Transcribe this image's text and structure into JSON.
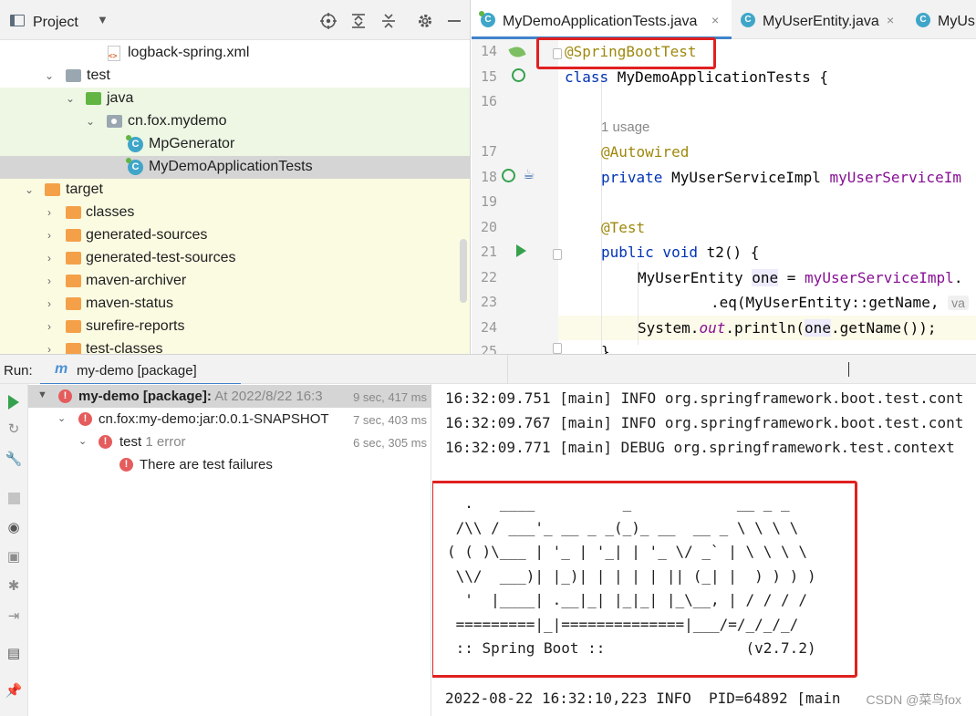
{
  "project": {
    "title": "Project",
    "tree": [
      {
        "label": "logback-spring.xml"
      },
      {
        "label": "test"
      },
      {
        "label": "java"
      },
      {
        "label": "cn.fox.mydemo"
      },
      {
        "label": "MpGenerator"
      },
      {
        "label": "MyDemoApplicationTests"
      },
      {
        "label": "target"
      },
      {
        "label": "classes"
      },
      {
        "label": "generated-sources"
      },
      {
        "label": "generated-test-sources"
      },
      {
        "label": "maven-archiver"
      },
      {
        "label": "maven-status"
      },
      {
        "label": "surefire-reports"
      },
      {
        "label": "test-classes"
      }
    ]
  },
  "editor": {
    "tabs": [
      {
        "label": "MyDemoApplicationTests.java",
        "close": "×"
      },
      {
        "label": "MyUserEntity.java",
        "close": "×"
      },
      {
        "label": "MyUs"
      }
    ],
    "line_numbers": [
      "14",
      "15",
      "16",
      "17",
      "18",
      "19",
      "20",
      "21",
      "22",
      "23",
      "24",
      "25"
    ],
    "usage_hint": "1 usage",
    "code": {
      "l14": "@SpringBootTest",
      "l15_kw": "class",
      "l15_rest": " MyDemoApplicationTests {",
      "l17": "@Autowired",
      "l18_kw": "private",
      "l18_type": " MyUserServiceImpl ",
      "l18_field": "myUserServiceIm",
      "l20": "@Test",
      "l21_kw": "public void",
      "l21_rest": " t2() {",
      "l22_type": "MyUserEntity ",
      "l22_var": "one",
      "l22_eq": " = ",
      "l22_field": "myUserServiceImpl",
      "l22_dot": ".",
      "l23": ".eq(MyUserEntity::getName, ",
      "l23_hint": "va",
      "l24_a": "System.",
      "l24_out": "out",
      "l24_b": ".println(",
      "l24_var": "one",
      "l24_c": ".getName());",
      "l25": "}"
    }
  },
  "run": {
    "label": "Run:",
    "tab": "my-demo [package]",
    "tests": [
      {
        "name": "my-demo [package]:",
        "meta": " At 2022/8/22 16:3",
        "time": "9 sec, 417 ms"
      },
      {
        "name": "cn.fox:my-demo:jar:0.0.1-SNAPSHOT",
        "meta": "",
        "time": "7 sec, 403 ms"
      },
      {
        "name": "test",
        "meta": " 1 error",
        "time": "6 sec, 305 ms"
      },
      {
        "name": "There are test failures",
        "meta": "",
        "time": ""
      }
    ]
  },
  "console": {
    "lines": [
      "16:32:09.751 [main] INFO org.springframework.boot.test.cont",
      "16:32:09.767 [main] INFO org.springframework.boot.test.cont",
      "16:32:09.771 [main] DEBUG org.springframework.test.context"
    ],
    "banner": "  .   ____          _            __ _ _\n /\\\\ / ___'_ __ _ _(_)_ __  __ _ \\ \\ \\ \\\n( ( )\\___ | '_ | '_| | '_ \\/ _` | \\ \\ \\ \\\n \\\\/  ___)| |_)| | | | | || (_| |  ) ) ) )\n  '  |____| .__|_| |_|_| |_\\__, | / / / /\n =========|_|==============|___/=/_/_/_/\n :: Spring Boot ::                (v2.7.2)",
    "last_line": "2022-08-22 16:32:10,223 INFO  PID=64892 [main",
    "watermark": "CSDN @菜鸟fox"
  },
  "colors": {
    "accent": "#4083c9",
    "error": "#e55c5c",
    "annotation": "#9e880d",
    "keyword": "#0033b3",
    "field": "#871094",
    "highlight_box": "#e02020"
  }
}
